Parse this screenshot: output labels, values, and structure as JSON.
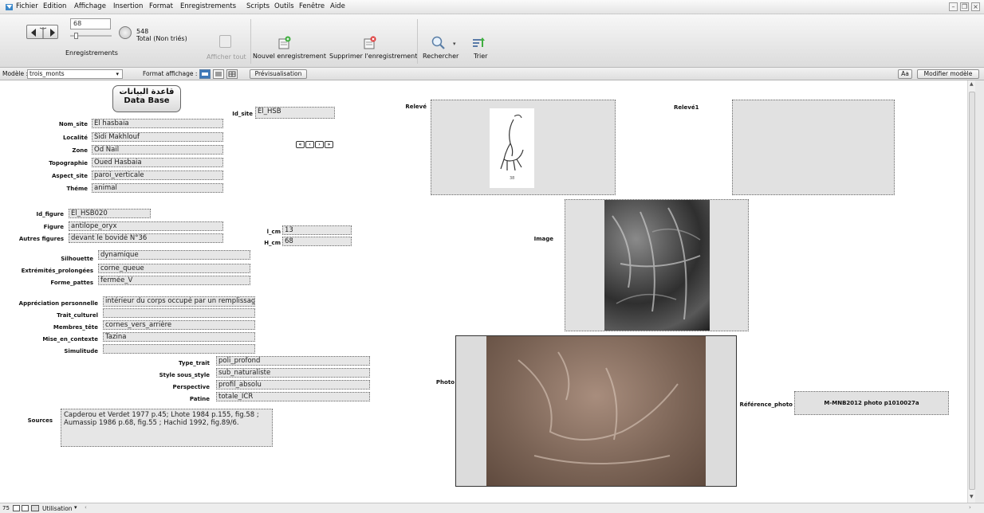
{
  "menu": {
    "items": [
      "Fichier",
      "Edition",
      "Affichage",
      "Insertion",
      "Format",
      "Enregistrements",
      "Scripts",
      "Outils",
      "Fenêtre",
      "Aide"
    ]
  },
  "toolbar": {
    "record_number": "68",
    "record_total": "548",
    "total_status": "Total (Non triés)",
    "records_label": "Enregistrements",
    "show_all_label": "Afficher tout",
    "new_record_label": "Nouvel enregistrement",
    "delete_record_label": "Supprimer l'enregistrement",
    "search_label": "Rechercher",
    "sort_label": "Trier"
  },
  "layoutbar": {
    "model_label": "Modèle :",
    "model_value": "trois_monts",
    "format_label": "Format affichage :",
    "preview_label": "Prévisualisation",
    "font_btn": "Aa",
    "edit_model_label": "Modifier modèle"
  },
  "form": {
    "header_ar": "قاعدة البيانات",
    "header_en": "Data Base",
    "fields": {
      "nom_site": {
        "label": "Nom_site",
        "value": "El hasbaia"
      },
      "localite": {
        "label": "Localité",
        "value": "Sidi Makhlouf"
      },
      "zone": {
        "label": "Zone",
        "value": "Od Nail"
      },
      "topographie": {
        "label": "Topographie",
        "value": "Oued Hasbaia"
      },
      "aspect_site": {
        "label": "Aspect_site",
        "value": "paroi_verticale"
      },
      "theme": {
        "label": "Théme",
        "value": "animal"
      },
      "id_site": {
        "label": "Id_site",
        "value": "El_HSB"
      },
      "id_figure": {
        "label": "Id_figure",
        "value": "El_HSB020"
      },
      "figure": {
        "label": "Figure",
        "value": "antilope_oryx"
      },
      "autres_figures": {
        "label": "Autres figures",
        "value": "devant le bovidé N°36"
      },
      "l_cm": {
        "label": "l_cm",
        "value": "13"
      },
      "h_cm": {
        "label": "H_cm",
        "value": "68"
      },
      "silhouette": {
        "label": "Silhouette",
        "value": "dynamique"
      },
      "extremites": {
        "label": "Extrémités_prolongées",
        "value": "corne_queue"
      },
      "forme_pattes": {
        "label": "Forme_pattes",
        "value": "fermée_V"
      },
      "appreciation": {
        "label": "Appréciation personnelle",
        "value": "intérieur du corps occupé par un remplissage"
      },
      "trait_culturel": {
        "label": "Trait_culturel",
        "value": ""
      },
      "membres_tete": {
        "label": "Membres_tête",
        "value": "cornes_vers_arrière"
      },
      "mise_en_contexte": {
        "label": "Mise_en_contexte",
        "value": "Tazina"
      },
      "simulitude": {
        "label": "Simulitude",
        "value": ""
      },
      "type_trait": {
        "label": "Type_trait",
        "value": "poli_profond"
      },
      "style": {
        "label": "Style sous_style",
        "value": "sub_naturaliste"
      },
      "perspective": {
        "label": "Perspective",
        "value": "profil_absolu"
      },
      "patine": {
        "label": "Patine",
        "value": "totale_ICR"
      },
      "sources": {
        "label": "Sources",
        "value": "Capderou et Verdet 1977 p.45; Lhote 1984 p.155, fig.58 ; Aumassip 1986 p.68, fig.55 ; Hachid 1992, fig.89/6."
      },
      "reference_photo": {
        "label": "Référence_photo",
        "value": "M-MNB2012 photo p1010027a"
      }
    },
    "images": {
      "releve_label": "Relevé",
      "releve_number": "38",
      "releve1_label": "Relevé1",
      "image_label": "Image",
      "photo_label": "Photo"
    },
    "nav": [
      "«",
      "‹",
      "›",
      "»"
    ]
  },
  "statusbar": {
    "zoom": "75",
    "mode": "Utilisation"
  }
}
